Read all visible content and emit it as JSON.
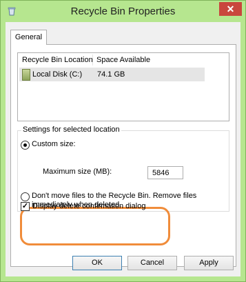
{
  "window": {
    "title": "Recycle Bin Properties",
    "close_symbol": "✕",
    "accent_color": "#c9463d"
  },
  "tabs": [
    {
      "label": "General"
    }
  ],
  "listview": {
    "columns": [
      "Recycle Bin Location",
      "Space Available"
    ],
    "rows": [
      {
        "location": "Local Disk (C:)",
        "space": "74.1 GB",
        "icon": "drive-icon"
      }
    ]
  },
  "settings": {
    "legend": "Settings for selected location",
    "custom_size_label": "Custom size:",
    "max_size_label": "Maximum size (MB):",
    "max_size_value": "5846",
    "dont_move_label_line1": "Don't move files to the Recycle Bin. Remove files",
    "dont_move_label_line2": "immediately when deleted.",
    "selected_option": "custom_size"
  },
  "confirm_dialog": {
    "label": "Display delete confirmation dialog",
    "checked": true,
    "check_symbol": "✓"
  },
  "buttons": {
    "ok": "OK",
    "cancel": "Cancel",
    "apply": "Apply"
  }
}
